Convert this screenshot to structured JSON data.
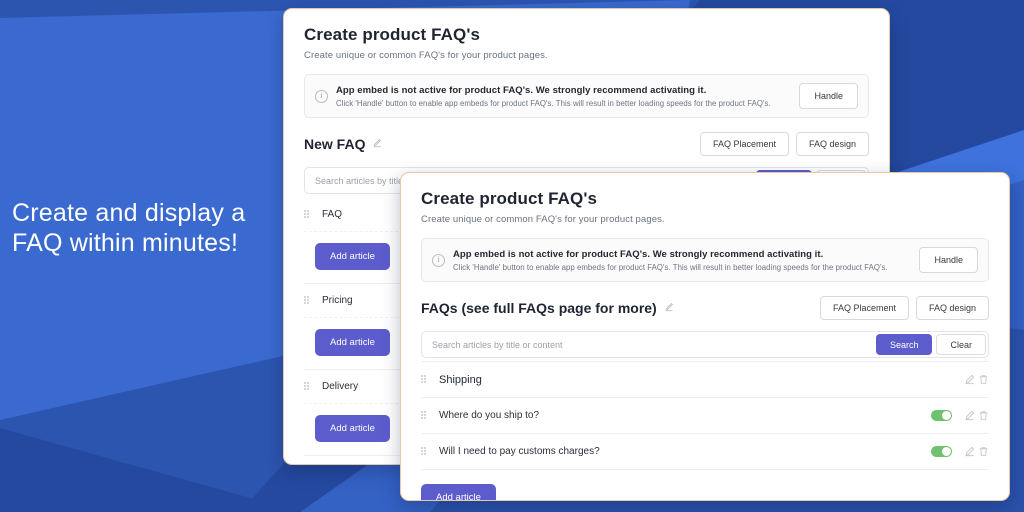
{
  "tagline": "Create and display a\nFAQ within minutes!",
  "colors": {
    "primary": "#5c5ccc",
    "toggle_on": "#6fc26f",
    "bg_blue": "#24499f",
    "card_border": "#e6c9a8"
  },
  "card_back": {
    "title": "Create product FAQ's",
    "subtitle": "Create unique or common FAQ's for your product pages.",
    "banner": {
      "icon": "info-icon",
      "heading": "App embed is not active for product FAQ's. We strongly recommend activating it.",
      "body": "Click 'Handle' button to enable app embeds for product FAQ's. This will result in better loading speeds for the product FAQ's.",
      "button": "Handle"
    },
    "heading": "New FAQ",
    "heading_edit_icon": "pencil-edit-icon",
    "placement_button": "FAQ Placement",
    "design_button": "FAQ design",
    "search": {
      "placeholder": "Search articles by title or content",
      "value": "",
      "search_button": "Search",
      "clear_button": "Clear"
    },
    "groups": [
      {
        "label": "FAQ",
        "add_button": "Add article"
      },
      {
        "label": "Pricing",
        "add_button": "Add article"
      },
      {
        "label": "Delivery",
        "add_button": "Add article"
      }
    ]
  },
  "card_front": {
    "title": "Create product FAQ's",
    "subtitle": "Create unique or common FAQ's for your product pages.",
    "banner": {
      "icon": "info-icon",
      "heading": "App embed is not active for product FAQ's. We strongly recommend activating it.",
      "body": "Click 'Handle' button to enable app embeds for product FAQ's. This will result in better loading speeds for the product FAQ's.",
      "button": "Handle"
    },
    "heading": "FAQs (see full FAQs page for more)",
    "heading_edit_icon": "pencil-edit-icon",
    "placement_button": "FAQ Placement",
    "design_button": "FAQ design",
    "search": {
      "placeholder": "Search articles by title or content",
      "value": "",
      "search_button": "Search",
      "clear_button": "Clear"
    },
    "rows": [
      {
        "label": "Shipping",
        "is_group": true,
        "toggle": null
      },
      {
        "label": "Where do you ship to?",
        "is_group": false,
        "toggle": "on"
      },
      {
        "label": "Will I need to pay customs charges?",
        "is_group": false,
        "toggle": "on"
      }
    ],
    "add_button": "Add article"
  }
}
